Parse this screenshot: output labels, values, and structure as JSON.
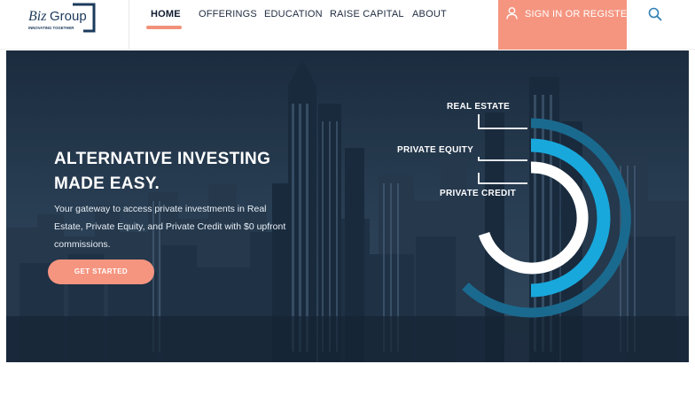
{
  "brand": {
    "name": "Biz Group",
    "tagline": "INNOVATING TOGETHER"
  },
  "nav": {
    "items": [
      {
        "label": "HOME",
        "active": true
      },
      {
        "label": "OFFERINGS",
        "active": false
      },
      {
        "label": "EDUCATION",
        "active": false
      },
      {
        "label": "RAISE CAPITAL",
        "active": false
      },
      {
        "label": "ABOUT",
        "active": false
      }
    ],
    "signin_label": "SIGN IN OR REGISTER",
    "user_icon": "user-icon",
    "search_icon": "search-icon"
  },
  "hero": {
    "title_line1": "ALTERNATIVE INVESTING",
    "title_line2": "MADE EASY.",
    "subtitle": "Your gateway to access private investments in Real Estate, Private Equity, and Private Credit with $0 upfront commissions.",
    "cta_label": "GET STARTED"
  },
  "graphic": {
    "labels": [
      "REAL ESTATE",
      "PRIVATE EQUITY",
      "PRIVATE CREDIT"
    ],
    "colors": {
      "real_estate": "#1a6a8f",
      "private_equity": "#19a8dc",
      "private_credit": "#ffffff"
    }
  },
  "colors": {
    "accent": "#f59580",
    "nav_text": "#1f2a3f",
    "search": "#2f7fb3"
  }
}
